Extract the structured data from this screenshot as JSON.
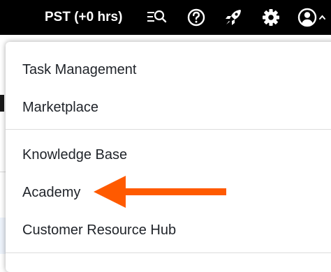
{
  "header": {
    "timezone": "PST (+0 hrs)",
    "icons": [
      "search-list-icon",
      "help-icon",
      "rocket-icon",
      "gear-icon",
      "user-account-icon"
    ]
  },
  "menu": {
    "groups": [
      {
        "items": [
          {
            "label": "Task Management"
          },
          {
            "label": "Marketplace"
          }
        ]
      },
      {
        "items": [
          {
            "label": "Knowledge Base"
          },
          {
            "label": "Academy"
          },
          {
            "label": "Customer Resource Hub"
          }
        ]
      }
    ]
  },
  "annotation": {
    "arrow_color": "#ff5a00",
    "points_to": "Academy"
  }
}
